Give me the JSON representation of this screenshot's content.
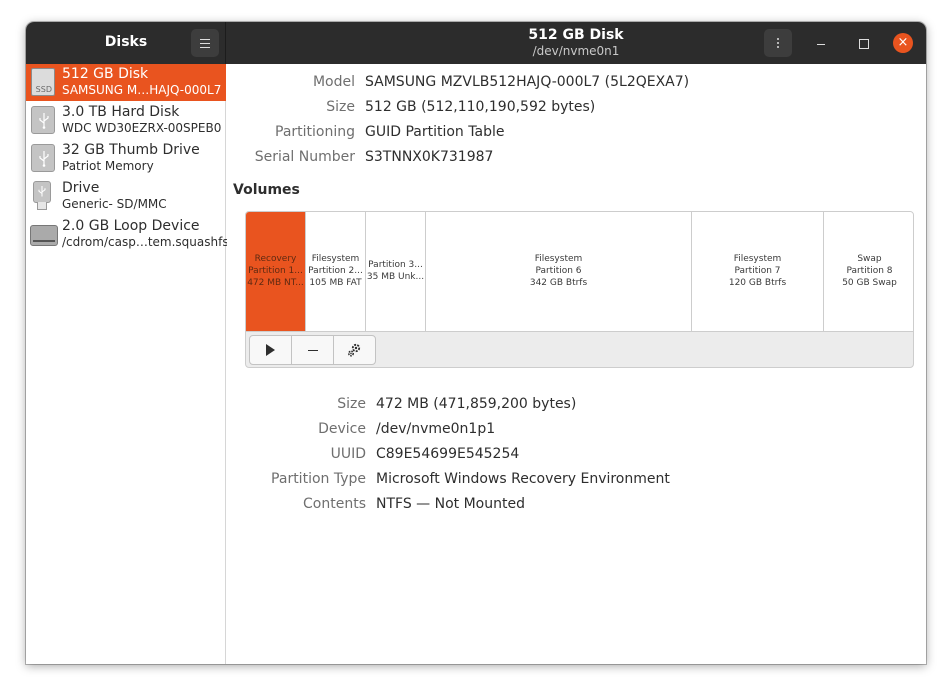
{
  "sidebar": {
    "title": "Disks",
    "items": [
      {
        "name": "512 GB Disk",
        "sub": "SAMSUNG M…HAJQ-000L7",
        "icon": "ssd-icon",
        "icon_text": "SSD",
        "selected": true
      },
      {
        "name": "3.0 TB Hard Disk",
        "sub": "WDC WD30EZRX-00SPEB0",
        "icon": "usb-drive-icon"
      },
      {
        "name": "32 GB Thumb Drive",
        "sub": "Patriot Memory",
        "icon": "usb-drive-icon"
      },
      {
        "name": "Drive",
        "sub": "Generic- SD/MMC",
        "icon": "sd-card-icon"
      },
      {
        "name": "2.0 GB Loop Device",
        "sub": "/cdrom/casp…tem.squashfs",
        "icon": "loop-device-icon"
      }
    ]
  },
  "header": {
    "title": "512 GB Disk",
    "subtitle": "/dev/nvme0n1",
    "close_glyph": "×"
  },
  "disk_info": {
    "model_label": "Model",
    "model": "SAMSUNG MZVLB512HAJQ-000L7 (5L2QEXA7)",
    "size_label": "Size",
    "size": "512 GB (512,110,190,592 bytes)",
    "partitioning_label": "Partitioning",
    "partitioning": "GUID Partition Table",
    "serial_label": "Serial Number",
    "serial": "S3TNNX0K731987"
  },
  "volumes": {
    "heading": "Volumes",
    "partitions": [
      {
        "line1": "Recovery",
        "line2": "Partition 1...",
        "line3": "472 MB NT...",
        "selected": true
      },
      {
        "line1": "Filesystem",
        "line2": "Partition 2...",
        "line3": "105 MB FAT"
      },
      {
        "line1": "",
        "line2": "Partition 3...",
        "line3": "35 MB Unk..."
      },
      {
        "line1": "Filesystem",
        "line2": "Partition 6",
        "line3": "342 GB Btrfs"
      },
      {
        "line1": "Filesystem",
        "line2": "Partition 7",
        "line3": "120 GB Btrfs"
      },
      {
        "line1": "Swap",
        "line2": "Partition 8",
        "line3": "50 GB Swap"
      }
    ],
    "toolbar": [
      "play-icon",
      "minus-icon",
      "gears-icon"
    ]
  },
  "partition_info": {
    "size_label": "Size",
    "size": "472 MB (471,859,200 bytes)",
    "device_label": "Device",
    "device": "/dev/nvme0n1p1",
    "uuid_label": "UUID",
    "uuid": "C89E54699E545254",
    "type_label": "Partition Type",
    "type": "Microsoft Windows Recovery Environment",
    "contents_label": "Contents",
    "contents": "NTFS — Not Mounted"
  },
  "colors": {
    "accent": "#e9541f",
    "titlebar": "#2c2c2c"
  }
}
